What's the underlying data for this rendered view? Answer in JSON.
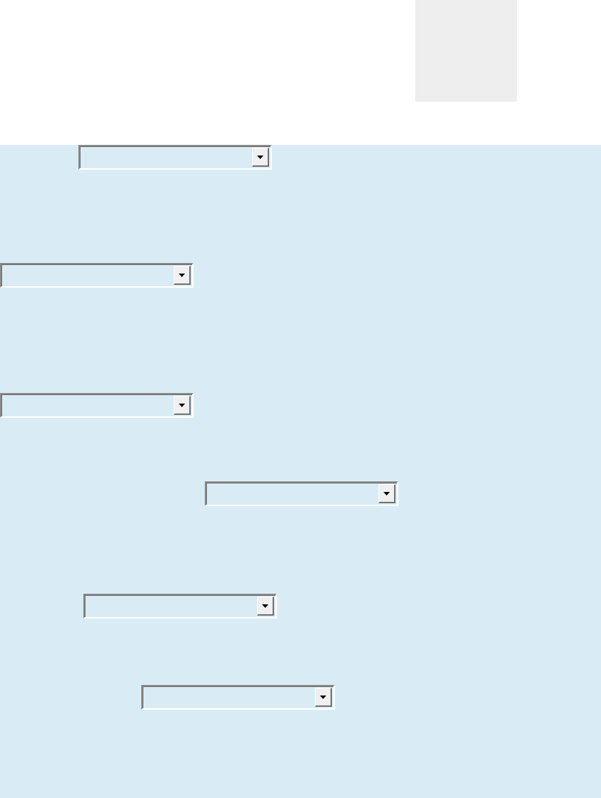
{
  "header": {
    "image": {
      "kind": "placeholder"
    }
  },
  "dropdowns": [
    {
      "kind": "dropdown"
    },
    {
      "kind": "dropdown"
    },
    {
      "kind": "dropdown"
    },
    {
      "kind": "dropdown"
    },
    {
      "kind": "dropdown"
    },
    {
      "kind": "dropdown"
    }
  ]
}
